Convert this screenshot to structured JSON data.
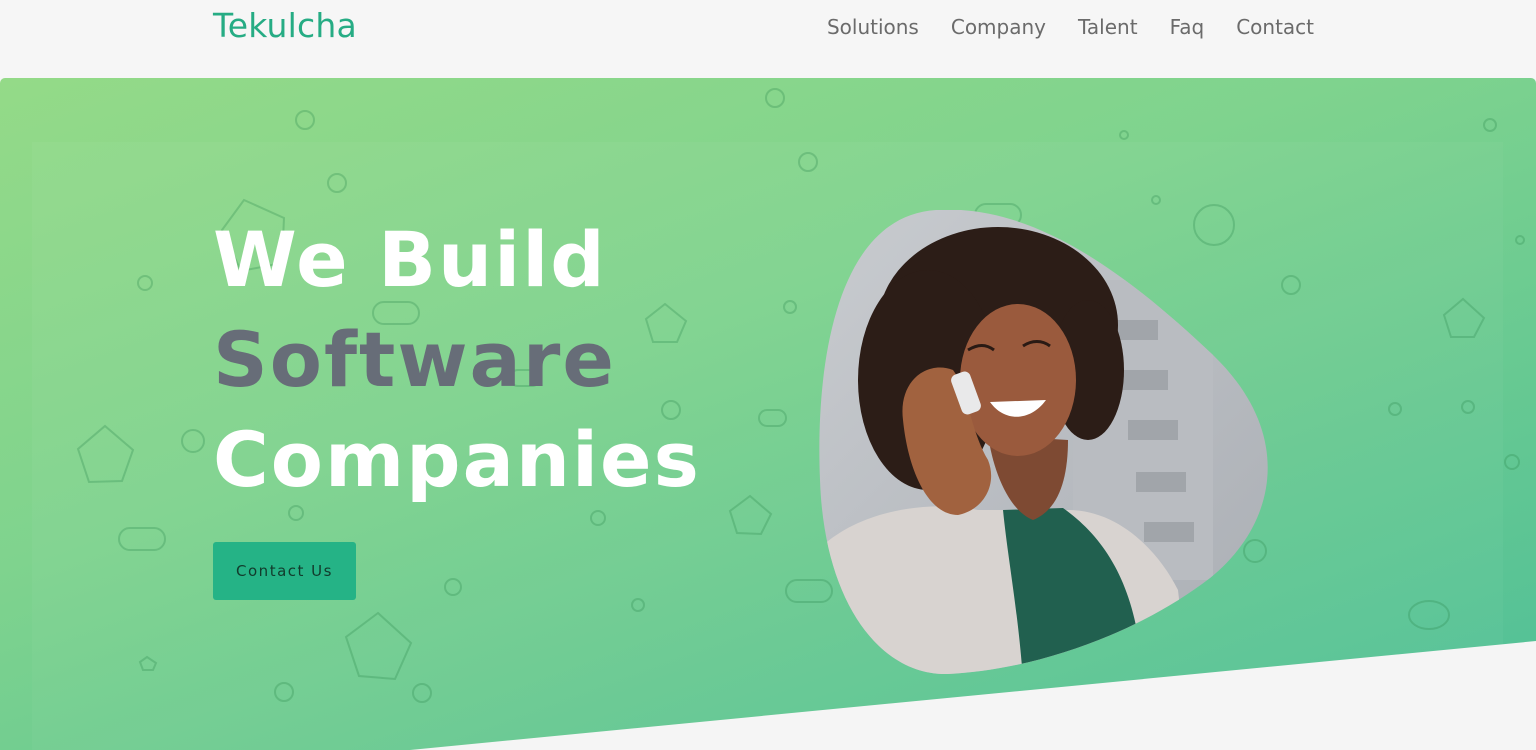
{
  "brand": {
    "name": "Tekulcha"
  },
  "nav": {
    "items": [
      {
        "label": "Solutions"
      },
      {
        "label": "Company"
      },
      {
        "label": "Talent"
      },
      {
        "label": "Faq"
      },
      {
        "label": "Contact"
      }
    ]
  },
  "hero": {
    "headline": {
      "line1": "We Build",
      "line2": "Software",
      "line3": "Companies"
    },
    "cta_label": "Contact Us",
    "photo_icon": "woman-on-phone-photo"
  },
  "colors": {
    "brand": "#26ac84",
    "nav_text": "#6b6b6b",
    "hero_gradient_start": "#94da88",
    "hero_gradient_end": "#4fbf98",
    "headline_white": "#ffffff",
    "headline_gray": "#676d78",
    "cta_bg": "#25b386"
  }
}
